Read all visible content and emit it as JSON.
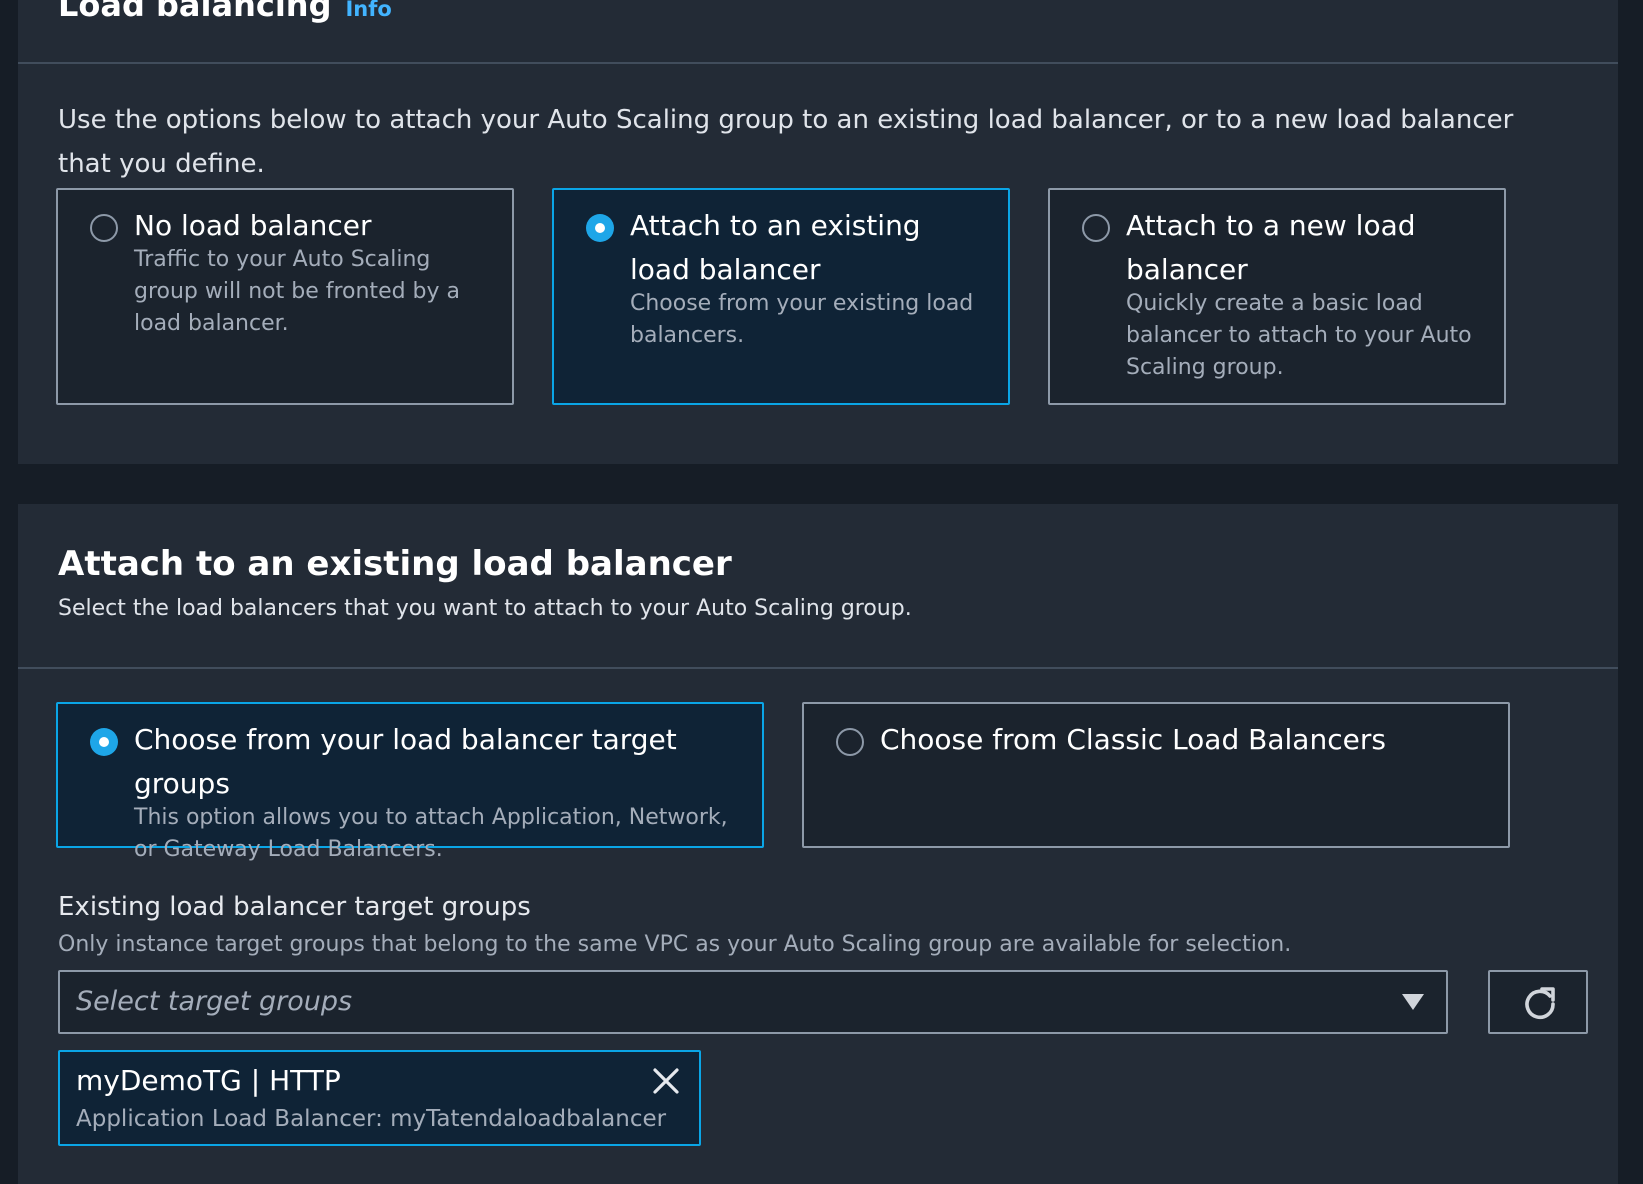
{
  "load_balancing": {
    "title": "Load balancing",
    "info_link": "Info",
    "intro": "Use the options below to attach your Auto Scaling group to an existing load balancer, or to a new load balancer that you define.",
    "options": [
      {
        "label": "No load balancer",
        "description": "Traffic to your Auto Scaling group will not be fronted by a load balancer.",
        "selected": false
      },
      {
        "label": "Attach to an existing load balancer",
        "description": "Choose from your existing load balancers.",
        "selected": true
      },
      {
        "label": "Attach to a new load balancer",
        "description": "Quickly create a basic load balancer to attach to your Auto Scaling group.",
        "selected": false
      }
    ]
  },
  "existing_lb": {
    "title": "Attach to an existing load balancer",
    "description": "Select the load balancers that you want to attach to your Auto Scaling group.",
    "options": [
      {
        "label": "Choose from your load balancer target groups",
        "description": "This option allows you to attach Application, Network, or Gateway Load Balancers.",
        "selected": true
      },
      {
        "label": "Choose from Classic Load Balancers",
        "description": "",
        "selected": false
      }
    ],
    "target_groups": {
      "label": "Existing load balancer target groups",
      "description": "Only instance target groups that belong to the same VPC as your Auto Scaling group are available for selection.",
      "placeholder": "Select target groups",
      "selected_tokens": [
        {
          "name": "myDemoTG | HTTP",
          "detail": "Application Load Balancer: myTatendaloadbalancer"
        }
      ]
    }
  },
  "colors": {
    "accent": "#0aa5e6",
    "link": "#42b4ff",
    "panel_bg": "#232b36",
    "page_bg": "#161d26"
  },
  "icons": [
    "refresh-icon",
    "close-icon",
    "caret-down-icon"
  ]
}
